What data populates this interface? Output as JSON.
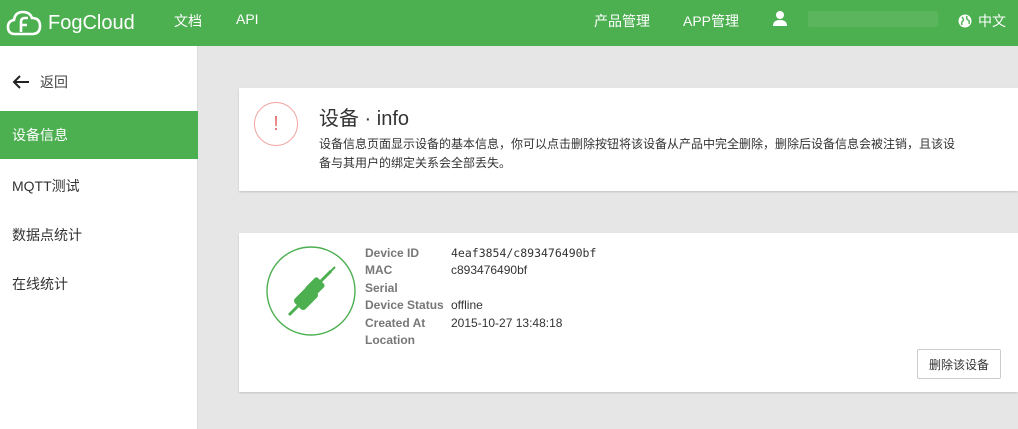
{
  "topbar": {
    "brand": "FogCloud",
    "nav_docs": "文档",
    "nav_api": "API",
    "nav_products": "产品管理",
    "nav_app": "APP管理",
    "lang": "中文"
  },
  "sidebar": {
    "back": "返回",
    "items": [
      {
        "label": "设备信息",
        "active": true
      },
      {
        "label": "MQTT测试",
        "active": false
      },
      {
        "label": "数据点统计",
        "active": false
      },
      {
        "label": "在线统计",
        "active": false
      }
    ]
  },
  "info": {
    "icon": "!",
    "title": "设备 · info",
    "desc": "设备信息页面显示设备的基本信息，你可以点击删除按钮将该设备从产品中完全删除，删除后设备信息会被注销，且该设备与其用户的绑定关系会全部丢失。"
  },
  "device": {
    "fields": [
      {
        "key": "Device ID",
        "value": "4eaf3854/c893476490bf"
      },
      {
        "key": "MAC",
        "value": "c893476490bf"
      },
      {
        "key": "Serial",
        "value": ""
      },
      {
        "key": "Device Status",
        "value": "offline"
      },
      {
        "key": "Created At",
        "value": "2015-10-27 13:48:18"
      },
      {
        "key": "Location",
        "value": ""
      }
    ],
    "delete_label": "删除该设备"
  },
  "colors": {
    "accent": "#4caf50",
    "warning": "#e57373"
  },
  "icons": [
    "cloud-logo-icon",
    "user-icon",
    "globe-icon",
    "back-arrow-icon",
    "warning-icon",
    "plug-icon"
  ]
}
